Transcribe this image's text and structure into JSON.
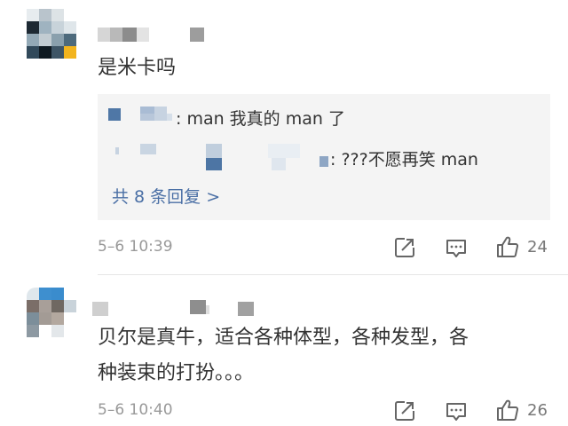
{
  "comments": [
    {
      "text": "是米卡吗",
      "replies": [
        {
          "text": ": man 我真的 man 了"
        },
        {
          "text": ": ???不愿再笑 man"
        }
      ],
      "more_replies": "共 8 条回复 >",
      "timestamp": "5–6 10:39",
      "like_count": "24"
    },
    {
      "text_line1": "贝尔是真牛，适合各种体型，各种发型，各",
      "text_line2": "种装束的打扮。。。",
      "timestamp": "5–6 10:40",
      "like_count": "26"
    }
  ],
  "icons": {
    "share": "share-icon",
    "comment": "comment-icon",
    "like": "thumb-up-icon"
  },
  "colors": {
    "link": "#4a6fa5",
    "meta": "#999999",
    "reply_bg": "#f4f4f4"
  }
}
